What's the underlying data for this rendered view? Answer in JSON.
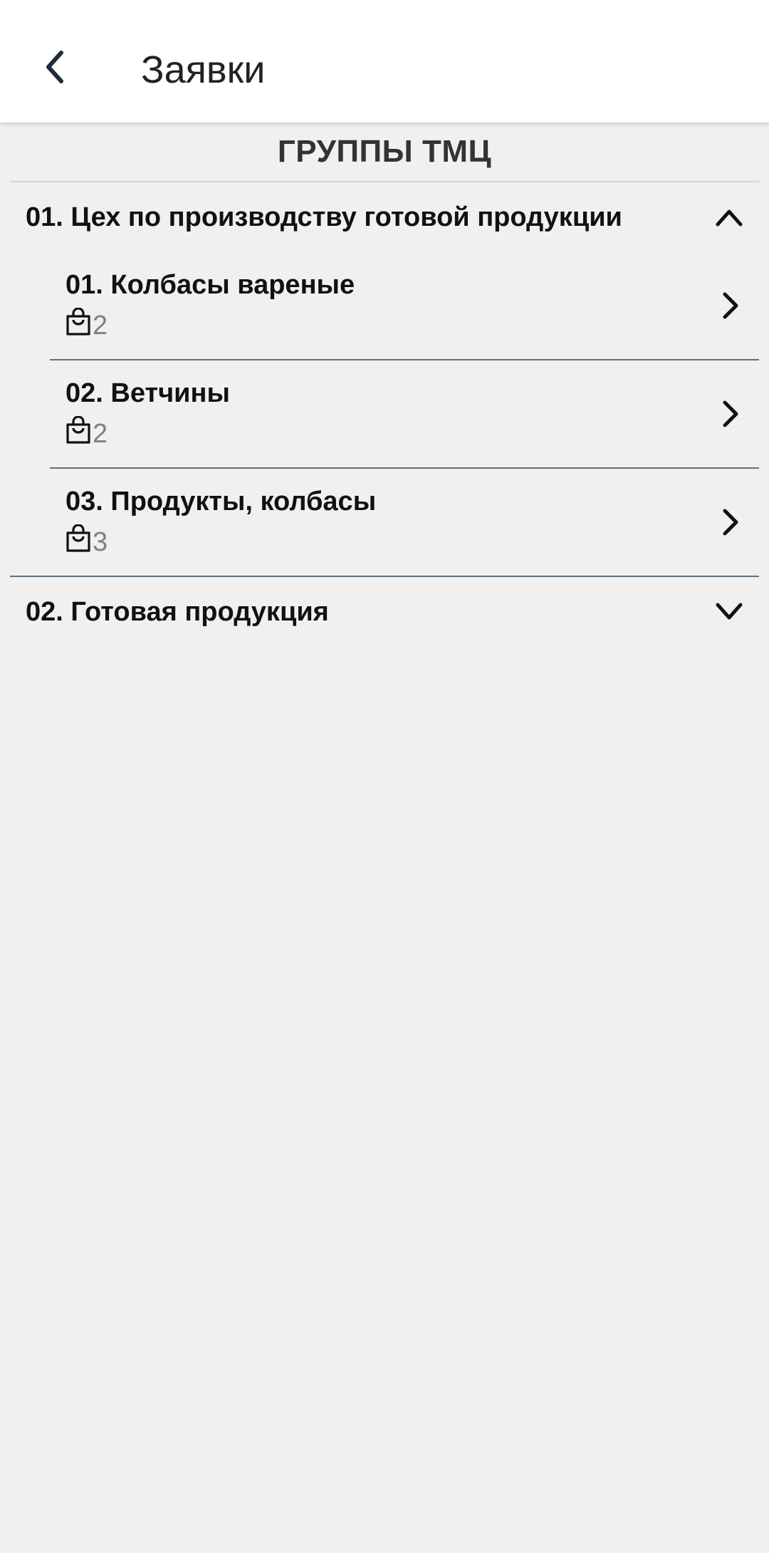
{
  "app_bar": {
    "title": "Заявки",
    "back_icon": "chevron-left-icon"
  },
  "section": {
    "header": "ГРУППЫ ТМЦ"
  },
  "groups": [
    {
      "label": "01. Цех по производству готовой продукции",
      "expanded": true,
      "chevron_icon": "chevron-up-icon",
      "items": [
        {
          "label": "01. Колбасы вареные",
          "count": "2",
          "icon": "shopping-bag-icon"
        },
        {
          "label": "02. Ветчины",
          "count": "2",
          "icon": "shopping-bag-icon"
        },
        {
          "label": "03. Продукты, колбасы",
          "count": "3",
          "icon": "shopping-bag-icon"
        }
      ]
    },
    {
      "label": "02. Готовая продукция",
      "expanded": false,
      "chevron_icon": "chevron-down-icon",
      "items": []
    }
  ],
  "colors": {
    "background": "#f0f0f0",
    "app_bar": "#ffffff",
    "divider": "#5f6f7c",
    "count_text": "#808080",
    "back_icon": "#1f2d3d"
  }
}
